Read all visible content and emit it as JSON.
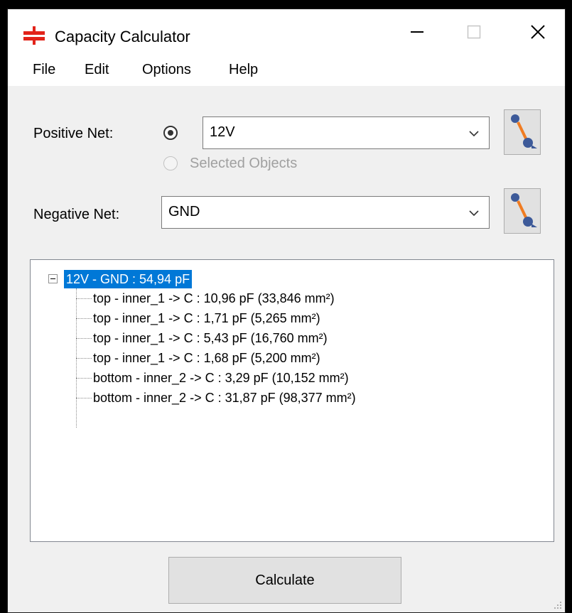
{
  "window": {
    "title": "Capacity Calculator"
  },
  "menu": {
    "items": [
      "File",
      "Edit",
      "Options",
      "Help"
    ]
  },
  "positive_net": {
    "label": "Positive Net:",
    "selected_value": "12V",
    "selected_objects_label": "Selected Objects"
  },
  "negative_net": {
    "label": "Negative Net:",
    "selected_value": "GND"
  },
  "tree": {
    "root": "12V - GND : 54,94 pF",
    "children": [
      "top - inner_1 -> C : 10,96 pF (33,846 mm²)",
      "top - inner_1 -> C : 1,71 pF (5,265 mm²)",
      "top - inner_1 -> C : 5,43 pF (16,760 mm²)",
      "top - inner_1 -> C : 1,68 pF (5,200 mm²)",
      "bottom - inner_2 -> C : 3,29 pF (10,152 mm²)",
      "bottom - inner_2 -> C : 31,87 pF (98,377 mm²)"
    ]
  },
  "actions": {
    "calculate_label": "Calculate"
  },
  "colors": {
    "selection": "#0078d7",
    "brand_red": "#e2231a",
    "pick_orange": "#f07c22",
    "pick_blue": "#3d5a99"
  },
  "icons": {
    "app": "capacitor-icon",
    "pick": "net-picker-icon"
  }
}
